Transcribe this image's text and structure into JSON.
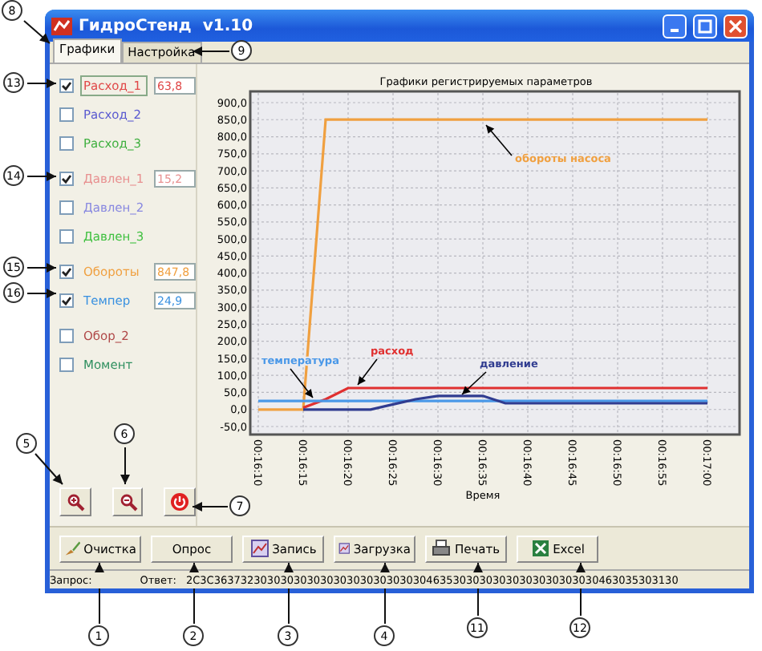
{
  "window": {
    "title": "ГидроСтенд  v1.10"
  },
  "tabs": [
    {
      "label": "Графики",
      "selected": true
    },
    {
      "label": "Настройка",
      "selected": false
    }
  ],
  "channel_groups": [
    {
      "channels": [
        {
          "name": "Расход_1",
          "checked": true,
          "focused": true,
          "color": "#e04848",
          "value": "63,8"
        },
        {
          "name": "Расход_2",
          "checked": false,
          "focused": false,
          "color": "#5a5ad0"
        },
        {
          "name": "Расход_3",
          "checked": false,
          "focused": false,
          "color": "#40b040"
        }
      ]
    },
    {
      "channels": [
        {
          "name": "Давлен_1",
          "checked": true,
          "focused": false,
          "color": "#e89090",
          "value": "15,2"
        },
        {
          "name": "Давлен_2",
          "checked": false,
          "focused": false,
          "color": "#8888e0"
        },
        {
          "name": "Давлен_3",
          "checked": false,
          "focused": false,
          "color": "#40c040"
        }
      ]
    },
    {
      "channels": [
        {
          "name": "Обороты",
          "checked": true,
          "focused": false,
          "color": "#f0a040",
          "value": "847,8"
        },
        {
          "name": "Темпер",
          "checked": true,
          "focused": false,
          "color": "#3890e0",
          "value": "24,9"
        }
      ]
    },
    {
      "channels": [
        {
          "name": "Обор_2",
          "checked": false,
          "focused": false,
          "color": "#b04848"
        },
        {
          "name": "Момент",
          "checked": false,
          "focused": false,
          "color": "#309060"
        }
      ]
    }
  ],
  "tools": [
    {
      "kind": "zoom-in"
    },
    {
      "kind": "zoom-out"
    },
    {
      "kind": "stop"
    }
  ],
  "chart": {
    "chart_data": {
      "type": "line",
      "title": "Графики регистрируемых параметров",
      "xlabel": "Время",
      "categories": [
        "00:16:10",
        null,
        "00:16:15",
        null,
        "00:16:20",
        null,
        "00:16:25",
        null,
        "00:16:30",
        null,
        "00:16:35",
        null,
        "00:16:40",
        null,
        "00:16:45",
        null,
        "00:16:50",
        null,
        "00:16:55",
        null,
        "00:17:00"
      ],
      "ylim": [
        -50,
        900
      ],
      "grid": true,
      "yticks": [
        {
          "value": 900,
          "label": "900,0"
        },
        {
          "value": 850,
          "label": "850,0"
        },
        {
          "value": 800,
          "label": "800,0"
        },
        {
          "value": 750,
          "label": "750,0"
        },
        {
          "value": 700,
          "label": "700,0"
        },
        {
          "value": 650,
          "label": "650,0"
        },
        {
          "value": 600,
          "label": "600,0"
        },
        {
          "value": 550,
          "label": "550,0"
        },
        {
          "value": 500,
          "label": "500,0"
        },
        {
          "value": 450,
          "label": "450,0"
        },
        {
          "value": 400,
          "label": "400,0"
        },
        {
          "value": 350,
          "label": "350,0"
        },
        {
          "value": 300,
          "label": "300,0"
        },
        {
          "value": 250,
          "label": "250,0"
        },
        {
          "value": 200,
          "label": "200,0"
        },
        {
          "value": 150,
          "label": "150,0"
        },
        {
          "value": 100,
          "label": "100,0"
        },
        {
          "value": 50,
          "label": "50,0"
        },
        {
          "value": 0,
          "label": "0,0"
        },
        {
          "value": -50,
          "label": "-50,0"
        }
      ],
      "series": [
        {
          "name": "обороты насоса",
          "color": "#f0a040",
          "values": [
            0,
            0,
            0,
            850,
            850,
            850,
            850,
            850,
            850,
            850,
            850,
            850,
            850,
            850,
            850,
            850,
            850,
            850,
            850,
            850,
            850
          ]
        },
        {
          "name": "расход",
          "color": "#e03030",
          "values": [
            null,
            null,
            5,
            30,
            63,
            63,
            63,
            63,
            63,
            63,
            63,
            63,
            63,
            63,
            63,
            63,
            63,
            63,
            63,
            63,
            63
          ]
        },
        {
          "name": "температура",
          "color": "#4a98e8",
          "values": [
            25,
            25,
            25,
            25,
            25,
            25,
            25,
            25,
            25,
            25,
            25,
            25,
            25,
            25,
            25,
            25,
            25,
            25,
            25,
            25,
            25
          ]
        },
        {
          "name": "давление",
          "color": "#303c90",
          "values": [
            null,
            null,
            0,
            0,
            0,
            0,
            15,
            30,
            40,
            40,
            40,
            18,
            18,
            18,
            18,
            18,
            18,
            18,
            18,
            18,
            18
          ]
        }
      ]
    }
  },
  "buttons": [
    {
      "label": "Очистка",
      "kind": "brush"
    },
    {
      "label": "Опрос",
      "kind": "plain"
    },
    {
      "label": "Запись",
      "kind": "chart"
    },
    {
      "label": "Загрузка",
      "kind": "chart"
    },
    {
      "label": "Печать",
      "kind": "printer"
    },
    {
      "label": "Excel",
      "kind": "excel"
    }
  ],
  "status_bar": {
    "request_label": "Запрос:",
    "response_label": "Ответ:",
    "response": "2C3C3637323030303030303030303030303046353030303030303030303030463035303130"
  },
  "callouts": [
    {
      "label": "8"
    },
    {
      "label": "9"
    },
    {
      "label": "13"
    },
    {
      "label": "14"
    },
    {
      "label": "15"
    },
    {
      "label": "16"
    },
    {
      "label": "5"
    },
    {
      "label": "6"
    },
    {
      "label": "7"
    },
    {
      "label": "1"
    },
    {
      "label": "2"
    },
    {
      "label": "3"
    },
    {
      "label": "4"
    },
    {
      "label": "11"
    },
    {
      "label": "12"
    }
  ]
}
